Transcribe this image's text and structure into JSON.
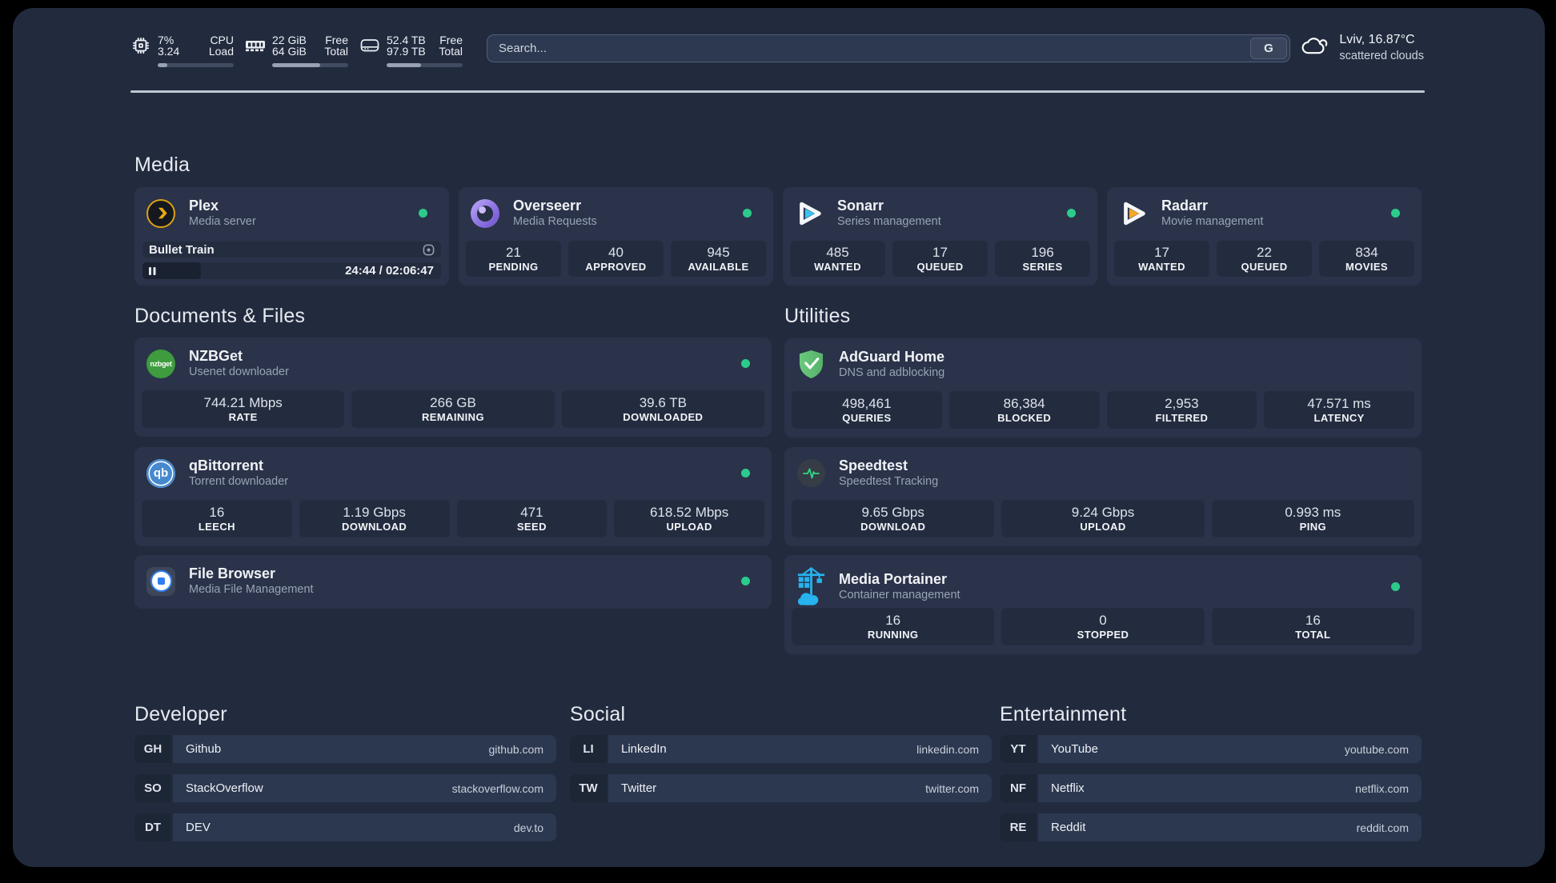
{
  "header": {
    "cpu": {
      "value_top": "7%",
      "value_bottom": "3.24",
      "label_top": "CPU",
      "label_bottom": "Load",
      "percent": 7
    },
    "ram": {
      "value_top": "22 GiB",
      "value_bottom": "64 GiB",
      "label_top": "Free",
      "label_bottom": "Total",
      "percent": 63
    },
    "disk": {
      "value_top": "52.4 TB",
      "value_bottom": "97.9 TB",
      "label_top": "Free",
      "label_bottom": "Total",
      "percent": 45
    },
    "search": {
      "placeholder": "Search...",
      "engine_key": "G"
    },
    "weather": {
      "location_temp": "Lviv, 16.87°C",
      "condition": "scattered clouds"
    }
  },
  "media": {
    "title": "Media",
    "cards": [
      {
        "name": "Plex",
        "desc": "Media server",
        "online": true,
        "now_playing": "Bullet Train",
        "time": "24:44 / 02:06:47",
        "progress_percent": 19.5
      },
      {
        "name": "Overseerr",
        "desc": "Media Requests",
        "online": true,
        "stats": [
          {
            "value": "21",
            "label": "PENDING"
          },
          {
            "value": "40",
            "label": "APPROVED"
          },
          {
            "value": "945",
            "label": "AVAILABLE"
          }
        ]
      },
      {
        "name": "Sonarr",
        "desc": "Series management",
        "online": true,
        "stats": [
          {
            "value": "485",
            "label": "WANTED"
          },
          {
            "value": "17",
            "label": "QUEUED"
          },
          {
            "value": "196",
            "label": "SERIES"
          }
        ]
      },
      {
        "name": "Radarr",
        "desc": "Movie management",
        "online": true,
        "stats": [
          {
            "value": "17",
            "label": "WANTED"
          },
          {
            "value": "22",
            "label": "QUEUED"
          },
          {
            "value": "834",
            "label": "MOVIES"
          }
        ]
      }
    ]
  },
  "documents": {
    "title": "Documents & Files",
    "cards": [
      {
        "name": "NZBGet",
        "desc": "Usenet downloader",
        "online": true,
        "stats": [
          {
            "value": "744.21 Mbps",
            "label": "RATE"
          },
          {
            "value": "266 GB",
            "label": "REMAINING"
          },
          {
            "value": "39.6 TB",
            "label": "DOWNLOADED"
          }
        ]
      },
      {
        "name": "qBittorrent",
        "desc": "Torrent downloader",
        "online": true,
        "stats": [
          {
            "value": "16",
            "label": "LEECH"
          },
          {
            "value": "1.19 Gbps",
            "label": "DOWNLOAD"
          },
          {
            "value": "471",
            "label": "SEED"
          },
          {
            "value": "618.52 Mbps",
            "label": "UPLOAD"
          }
        ]
      },
      {
        "name": "File Browser",
        "desc": "Media File Management",
        "online": true
      }
    ]
  },
  "utilities": {
    "title": "Utilities",
    "cards": [
      {
        "name": "AdGuard Home",
        "desc": "DNS and adblocking",
        "stats": [
          {
            "value": "498,461",
            "label": "QUERIES"
          },
          {
            "value": "86,384",
            "label": "BLOCKED"
          },
          {
            "value": "2,953",
            "label": "FILTERED"
          },
          {
            "value": "47.571 ms",
            "label": "LATENCY"
          }
        ]
      },
      {
        "name": "Speedtest",
        "desc": "Speedtest Tracking",
        "stats": [
          {
            "value": "9.65 Gbps",
            "label": "DOWNLOAD"
          },
          {
            "value": "9.24 Gbps",
            "label": "UPLOAD"
          },
          {
            "value": "0.993 ms",
            "label": "PING"
          }
        ]
      },
      {
        "name": "Media Portainer",
        "desc": "Container management",
        "online": true,
        "stats": [
          {
            "value": "16",
            "label": "RUNNING"
          },
          {
            "value": "0",
            "label": "STOPPED"
          },
          {
            "value": "16",
            "label": "TOTAL"
          }
        ]
      }
    ]
  },
  "links": [
    {
      "title": "Developer",
      "items": [
        {
          "badge": "GH",
          "name": "Github",
          "url": "github.com"
        },
        {
          "badge": "SO",
          "name": "StackOverflow",
          "url": "stackoverflow.com"
        },
        {
          "badge": "DT",
          "name": "DEV",
          "url": "dev.to"
        }
      ]
    },
    {
      "title": "Social",
      "items": [
        {
          "badge": "LI",
          "name": "LinkedIn",
          "url": "linkedin.com"
        },
        {
          "badge": "TW",
          "name": "Twitter",
          "url": "twitter.com"
        }
      ]
    },
    {
      "title": "Entertainment",
      "items": [
        {
          "badge": "YT",
          "name": "YouTube",
          "url": "youtube.com"
        },
        {
          "badge": "NF",
          "name": "Netflix",
          "url": "netflix.com"
        },
        {
          "badge": "RE",
          "name": "Reddit",
          "url": "reddit.com"
        }
      ]
    }
  ],
  "colors": {
    "background": "#222b3e",
    "card": "#2a3349",
    "accent_green": "#2bcb8c",
    "plex_orange": "#dda213",
    "sonarr_blue": "#37c3f1",
    "radarr_orange": "#f9a825",
    "adguard_green": "#63bf75",
    "portainer_blue": "#27b3ee",
    "speedtest_green": "#2fd783"
  }
}
